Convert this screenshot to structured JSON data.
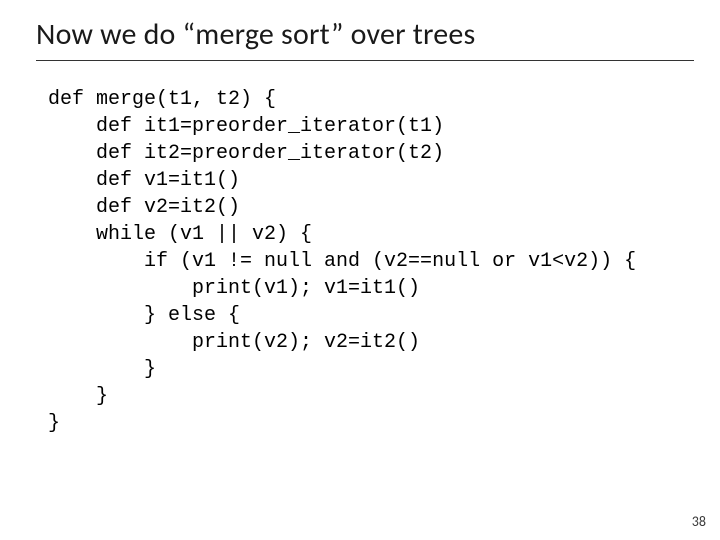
{
  "title": "Now we do “merge sort” over trees",
  "code": {
    "l1": "def merge(t1, t2) {",
    "l2": "    def it1=preorder_iterator(t1)",
    "l3": "    def it2=preorder_iterator(t2)",
    "l4": "    def v1=it1()",
    "l5": "    def v2=it2()",
    "l6": "    while (v1 || v2) {",
    "l7": "        if (v1 != null and (v2==null or v1<v2)) {",
    "l8": "            print(v1); v1=it1()",
    "l9": "        } else {",
    "l10": "            print(v2); v2=it2()",
    "l11": "        }",
    "l12": "    }",
    "l13": "}"
  },
  "page_number": "38"
}
